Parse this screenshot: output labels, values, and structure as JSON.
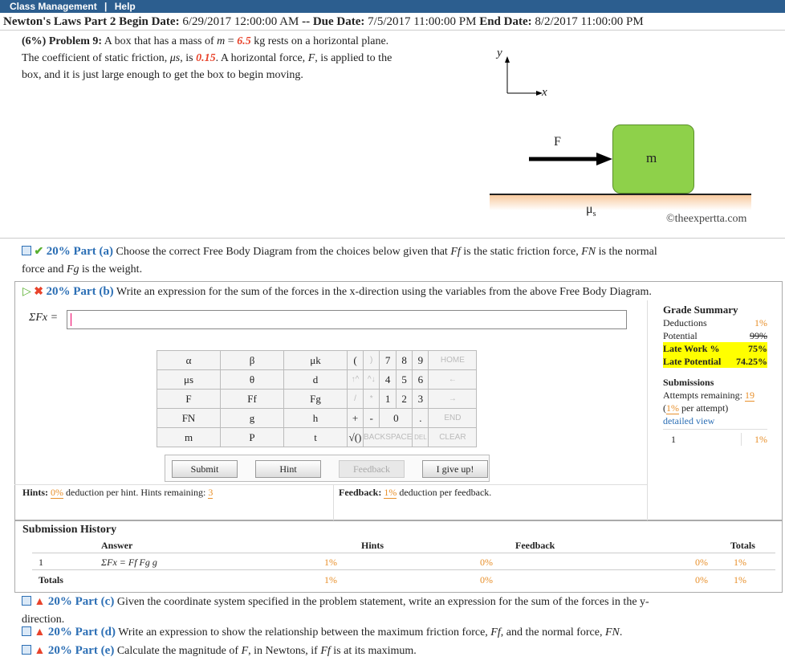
{
  "topbar": {
    "items": [
      "Class Management",
      "|",
      "Help"
    ]
  },
  "titlebar": {
    "assignment": "Newton's Laws Part 2",
    "begin_label": "Begin Date:",
    "begin_date": "6/29/2017 12:00:00 AM",
    "sep": "--",
    "due_label": "Due Date:",
    "due_date": "7/5/2017 11:00:00 PM",
    "end_label": "End Date:",
    "end_date": "8/2/2017 11:00:00 PM"
  },
  "problem": {
    "weight": "(6%)",
    "label": "Problem 9:",
    "text1": "A box that has a mass of",
    "m_var": "m",
    "eq": "=",
    "mass_value": "6.5",
    "mass_unit": "kg rests on a horizontal plane.",
    "text2": "The coefficient of static friction,",
    "mu_var": "μs",
    "is": ", is",
    "mu_value": "0.15",
    "text3": ". A horizontal force,",
    "f_var": "F",
    "text4": ", is applied to the",
    "text5": "box, and it is just large enough to get the box to begin moving."
  },
  "figure": {
    "axis_y": "y",
    "axis_x": "x",
    "force_label": "F",
    "box_label": "m",
    "mu_label": "μ",
    "mu_sub": "s",
    "copyright": "©theexpertta.com",
    "box_color": "#8ed14a",
    "plane_color": "#f8c89a"
  },
  "parts": {
    "a": {
      "header": "20% Part (a)",
      "text": "Choose the correct Free Body Diagram from the choices below given that",
      "ff": "Ff",
      "t2": "is the static friction force,",
      "fn": "FN",
      "t3": "is the normal",
      "t4": "force and",
      "fg": "Fg",
      "t5": "is the weight."
    },
    "b": {
      "header": "20% Part (b)",
      "text": "Write an expression for the sum of the forces in the x-direction using the variables from the above Free Body Diagram."
    },
    "c": {
      "header": "20% Part (c)",
      "text": "Given the coordinate system specified in the problem statement, write an expression for the sum of the forces in the y-",
      "text2": "direction."
    },
    "d": {
      "header": "20% Part (d)",
      "text": "Write an expression to show the relationship between the maximum friction force,",
      "ff": "Ff",
      "t2": ", and the normal force,",
      "fn": "FN",
      "t3": "."
    },
    "e": {
      "header": "20% Part (e)",
      "text": "Calculate the magnitude of",
      "f": "F",
      "t2": ", in Newtons, if",
      "ff": "Ff",
      "t3": "is at its maximum."
    }
  },
  "equation": {
    "label": "ΣFx =",
    "value": ""
  },
  "keypad": {
    "rows": [
      [
        "α",
        "β",
        "μk"
      ],
      [
        "μs",
        "θ",
        "d"
      ],
      [
        "F",
        "Ff",
        "Fg"
      ],
      [
        "FN",
        "g",
        "h"
      ],
      [
        "m",
        "P",
        "t"
      ]
    ]
  },
  "numpad": {
    "r1": [
      "(",
      ")",
      "7",
      "8",
      "9",
      "HOME"
    ],
    "r2": [
      "↑^",
      "^↓",
      "4",
      "5",
      "6",
      "←"
    ],
    "r3": [
      "/",
      "*",
      "1",
      "2",
      "3",
      "→"
    ],
    "r4": [
      "+",
      "-",
      "0",
      ".",
      "END"
    ],
    "r5": [
      "√()",
      "BACKSPACE",
      "DEL",
      "CLEAR"
    ]
  },
  "buttons": {
    "submit": "Submit",
    "hint": "Hint",
    "feedback": "Feedback",
    "giveup": "I give up!"
  },
  "hints": {
    "label": "Hints:",
    "pct": "0%",
    "text": "deduction per hint. Hints remaining:",
    "remaining": "3"
  },
  "feedback": {
    "label": "Feedback:",
    "pct": "1%",
    "text": "deduction per feedback."
  },
  "grade": {
    "title": "Grade Summary",
    "deductions_label": "Deductions",
    "deductions": "1%",
    "potential_label": "Potential",
    "potential": "99%",
    "late_work_label": "Late Work %",
    "late_work": "75%",
    "late_potential_label": "Late Potential",
    "late_potential": "74.25%",
    "submissions_title": "Submissions",
    "attempts_label": "Attempts remaining:",
    "attempts": "19",
    "per_attempt_pct": "1%",
    "per_attempt_text": "per attempt)",
    "per_attempt_open": "(",
    "detailed": "detailed view",
    "sub_num": "1",
    "sub_pct": "1%"
  },
  "history": {
    "title": "Submission History",
    "col_answer": "Answer",
    "col_hints": "Hints",
    "col_feedback": "Feedback",
    "col_totals": "Totals",
    "row_num": "1",
    "row_answer": "ΣFx = Ff Fg g",
    "row_pct": "1%",
    "row_hints": "0%",
    "row_fb": "0%",
    "row_total": "1%",
    "totals_label": "Totals",
    "t_pct": "1%",
    "t_hints": "0%",
    "t_fb": "0%",
    "t_total": "1%"
  }
}
